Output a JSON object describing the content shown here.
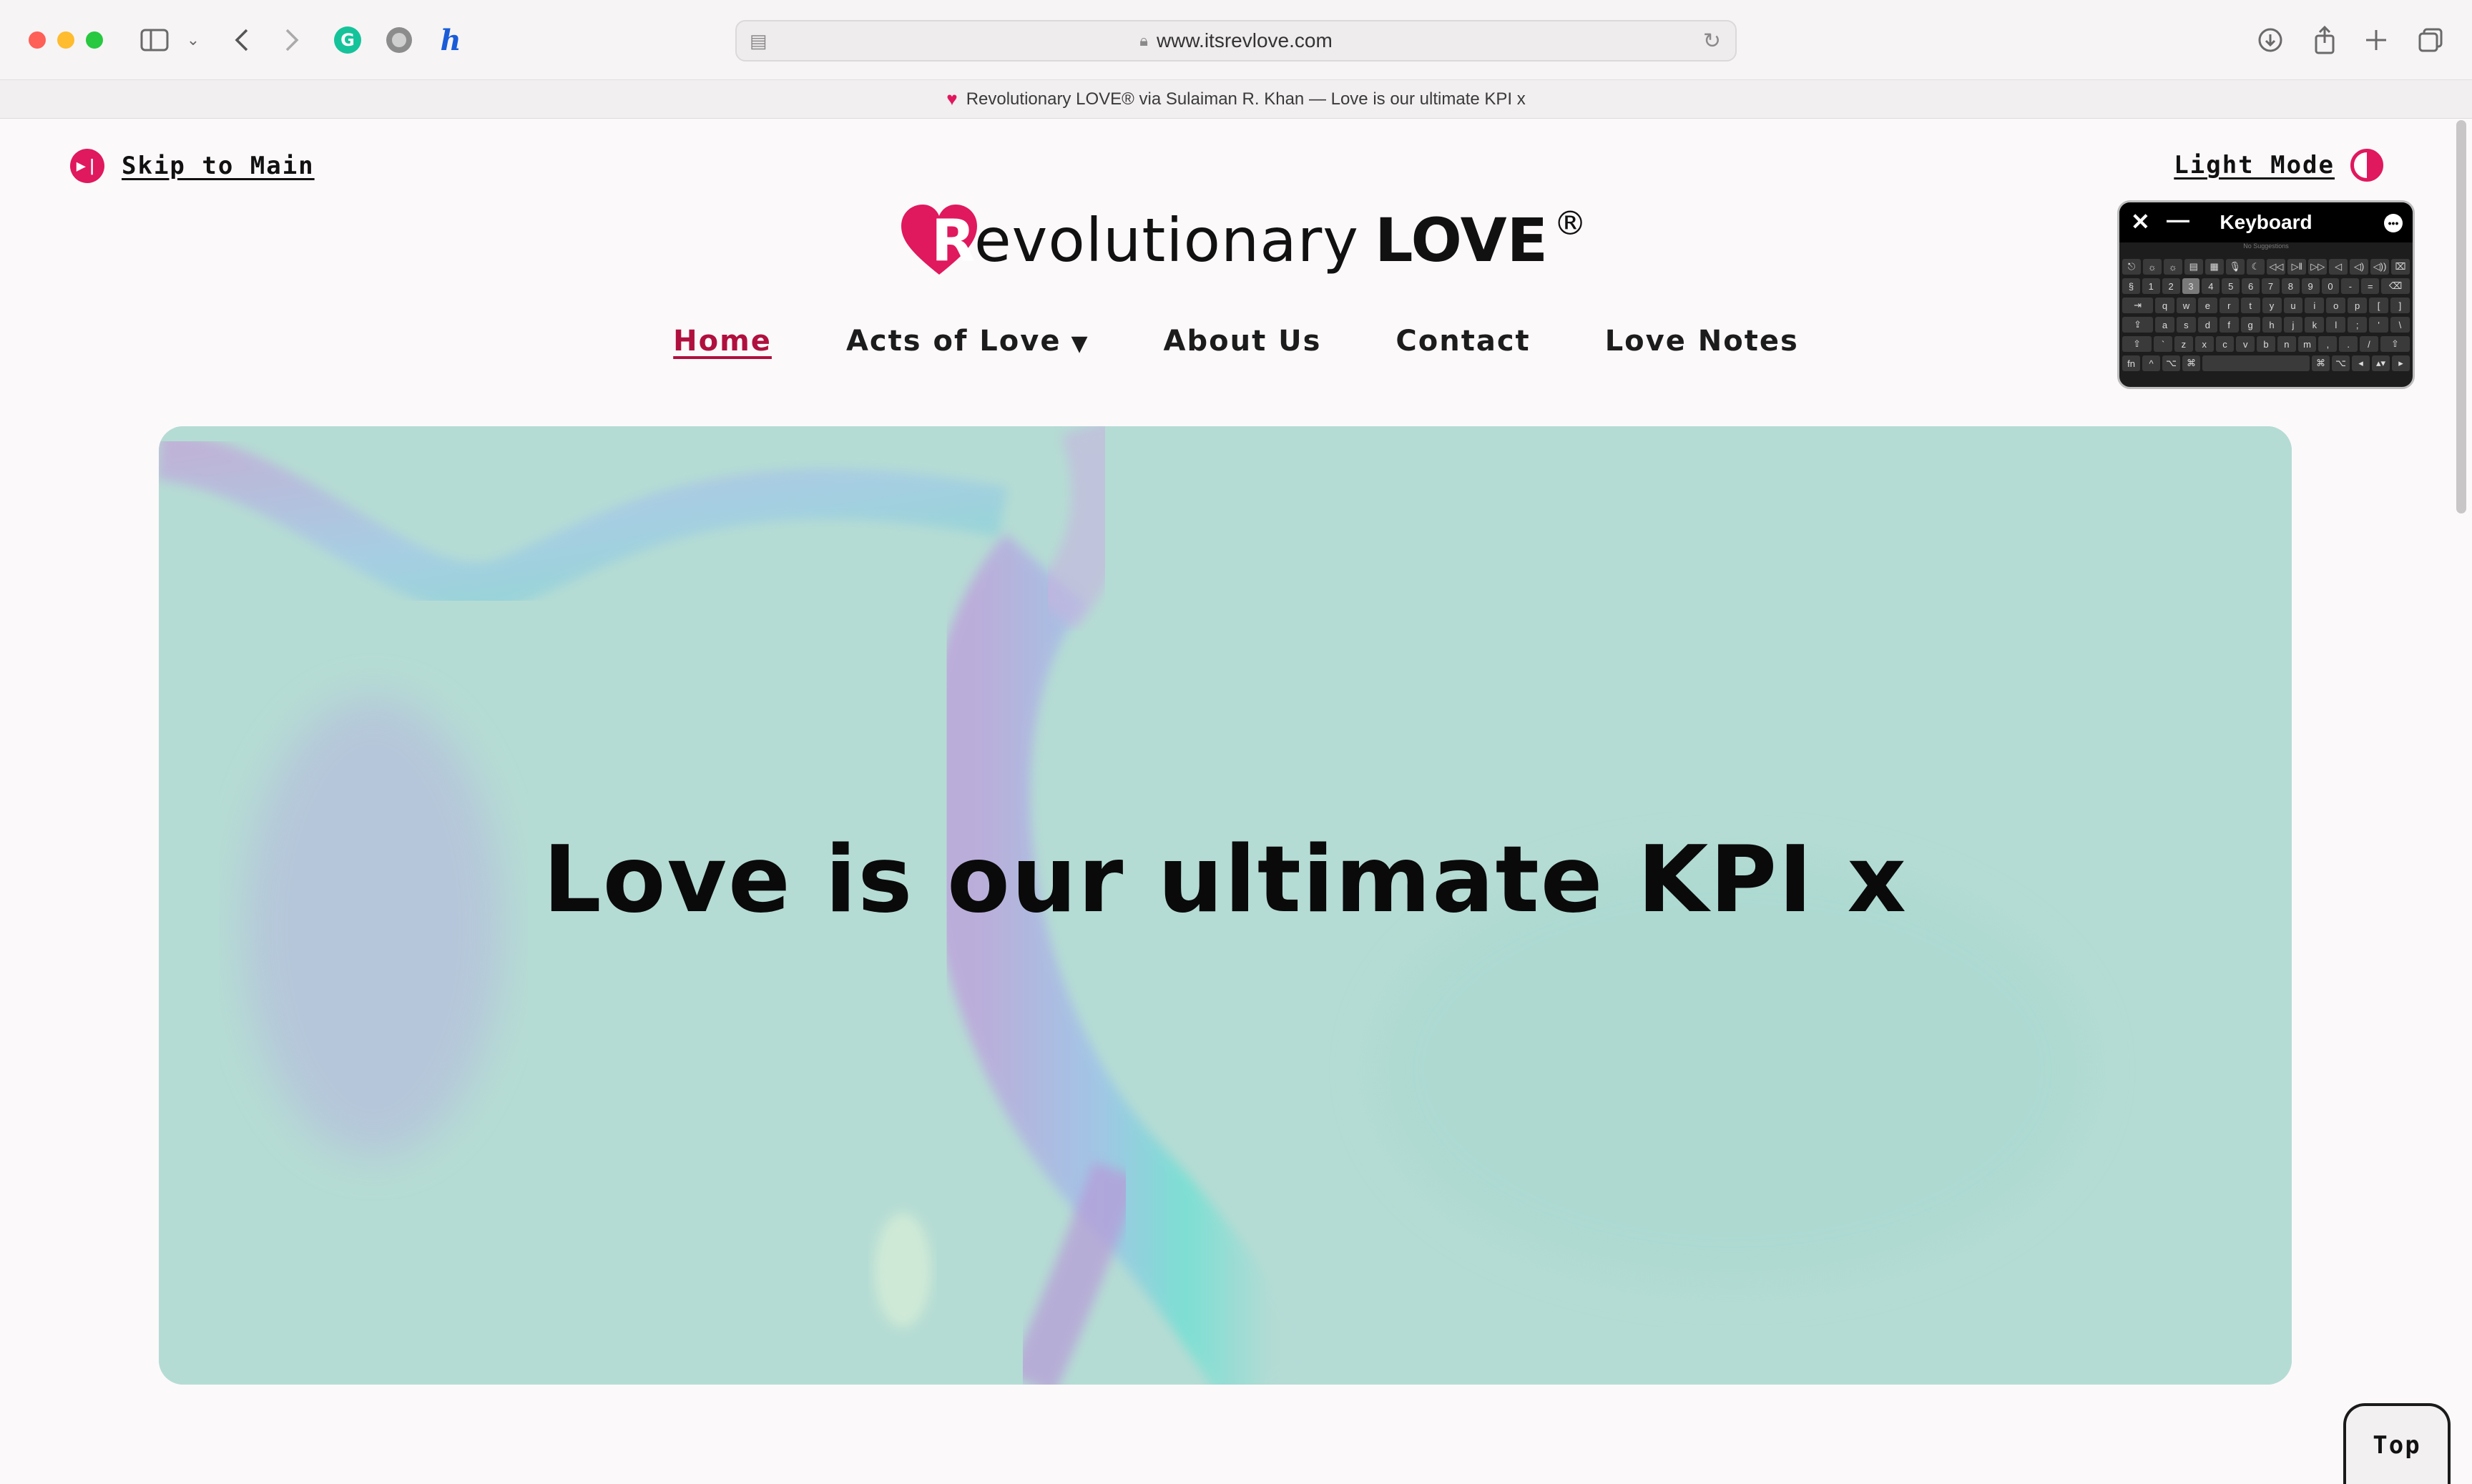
{
  "browser": {
    "url": "www.itsrevlove.com",
    "tab_title": "Revolutionary LOVE® via Sulaiman R. Khan — Love is our ultimate KPI x",
    "toolbar_icons": [
      "sidebar-icon",
      "chevron-down-icon",
      "back-icon",
      "forward-icon",
      "grammarly-icon",
      "globe-icon",
      "honey-icon",
      "download-icon",
      "share-icon",
      "new-tab-icon",
      "tab-overview-icon"
    ]
  },
  "page": {
    "skip_label": "Skip to Main",
    "light_mode_label": "Light Mode",
    "logo": {
      "letter": "R",
      "text": "evolutionary",
      "love": "LOVE",
      "reg": "®"
    },
    "nav": [
      {
        "label": "Home",
        "active": true
      },
      {
        "label": "Acts of Love",
        "dropdown": true
      },
      {
        "label": "About Us"
      },
      {
        "label": "Contact"
      },
      {
        "label": "Love Notes"
      }
    ],
    "nav_caret": "▼",
    "hero_title": "Love is our ultimate KPI x",
    "top_label": "Top"
  },
  "keyboard": {
    "title": "Keyboard",
    "suggestions": "No Suggestions",
    "rows": [
      [
        "⎋",
        "☼",
        "☼",
        "▤",
        "▦",
        "🎙",
        "☾",
        "◁◁",
        "▷‖",
        "▷▷",
        "◁",
        "◁)",
        "◁))",
        "⌧"
      ],
      [
        "§",
        "1",
        "2",
        "3",
        "4",
        "5",
        "6",
        "7",
        "8",
        "9",
        "0",
        "-",
        "=",
        "⌫"
      ],
      [
        "⇥",
        "q",
        "w",
        "e",
        "r",
        "t",
        "y",
        "u",
        "i",
        "o",
        "p",
        "[",
        "]"
      ],
      [
        "⇪",
        "a",
        "s",
        "d",
        "f",
        "g",
        "h",
        "j",
        "k",
        "l",
        ";",
        "'",
        "\\"
      ],
      [
        "⇧",
        "`",
        "z",
        "x",
        "c",
        "v",
        "b",
        "n",
        "m",
        ",",
        ".",
        "/",
        "⇧"
      ],
      [
        "fn",
        "^",
        "⌥",
        "⌘",
        "",
        "⌘",
        "⌥",
        "◂",
        "▴▾",
        "▸"
      ]
    ],
    "accent": "#e0185e"
  },
  "colors": {
    "brand": "#e0185e",
    "active_nav": "#b0103e",
    "hero_bg": "#b5dcd4"
  }
}
